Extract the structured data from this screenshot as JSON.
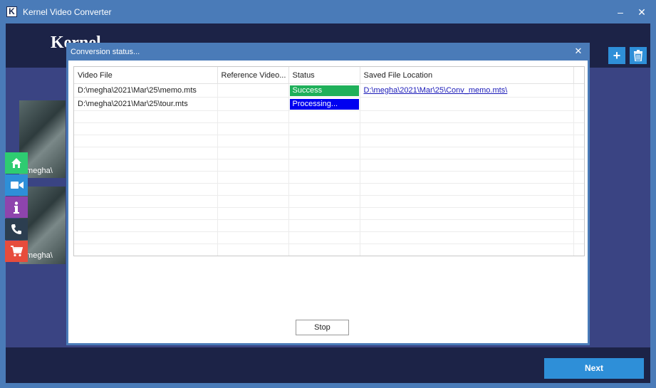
{
  "window": {
    "title": "Kernel Video Converter",
    "icon_letter": "K",
    "minimize_glyph": "–",
    "close_glyph": "✕"
  },
  "header": {
    "brand": "Kernel",
    "add_glyph": "+",
    "delete_icon": "trash-icon"
  },
  "thumbnails": [
    {
      "label": "D:\\megha\\"
    },
    {
      "label": "D:\\megha\\"
    }
  ],
  "side_nav": [
    {
      "icon": "home-icon",
      "color": "#2ecc71"
    },
    {
      "icon": "video-camera-icon",
      "color": "#2e8fd8"
    },
    {
      "icon": "info-icon",
      "color": "#8e44ad"
    },
    {
      "icon": "phone-icon",
      "color": "#2c3e50"
    },
    {
      "icon": "cart-icon",
      "color": "#e74c3c"
    }
  ],
  "dialog": {
    "title": "Conversion status...",
    "close_glyph": "✕",
    "columns": [
      "Video File",
      "Reference Video...",
      "Status",
      "Saved File Location"
    ],
    "rows": [
      {
        "file": "D:\\megha\\2021\\Mar\\25\\memo.mts",
        "reference": "",
        "status": "Success",
        "location": "D:\\megha\\2021\\Mar\\25\\Conv_memo.mts\\"
      },
      {
        "file": "D:\\megha\\2021\\Mar\\25\\tour.mts",
        "reference": "",
        "status": "Processing...",
        "location": ""
      }
    ],
    "stop_label": "Stop"
  },
  "footer": {
    "next_label": "Next"
  },
  "colors": {
    "success": "#1fb05a",
    "processing": "#0000f0",
    "accent": "#2e8fd8"
  }
}
